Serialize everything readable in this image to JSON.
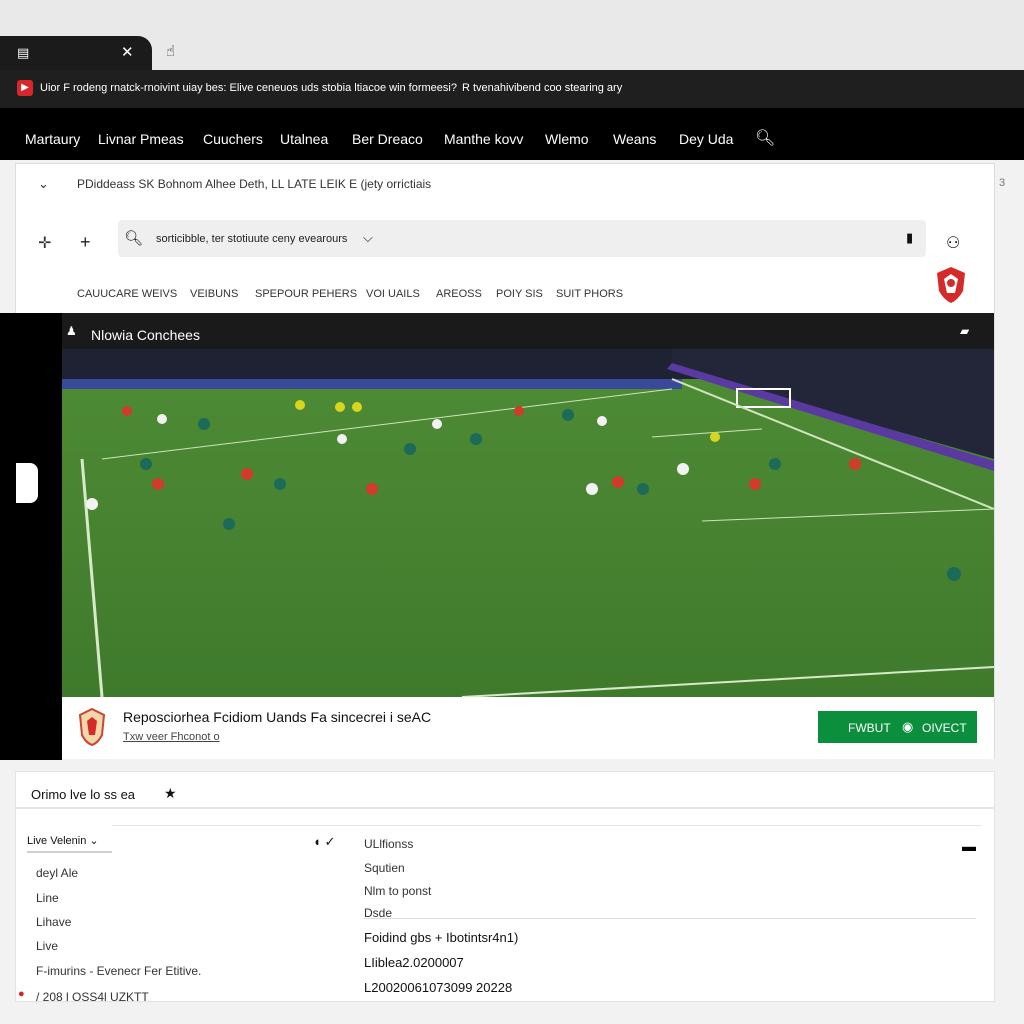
{
  "browser": {
    "tab_close": "✕",
    "new_tab_icon": "☝"
  },
  "alert": {
    "badge": "▶",
    "text_primary": "Uior F rodeng rnatck-rnoivint uiay bes: Elive ceneuos uds stobia ltiacoe win formeesi?",
    "text_secondary": "R  tvenahivibend coo stearing ary"
  },
  "nav": {
    "items": [
      "Martaury",
      "Livnar Pmeas",
      "Cuuchers",
      "Utalnea",
      "Ber Dreaco",
      "Manthe kovv",
      "Wlemo",
      "Weans",
      "Dey Uda"
    ]
  },
  "header": {
    "breadcrumb": "PDiddeass SK Bohnom Alhee Deth, LL LATE LEIK E (jety orrictiais",
    "scroll_indicator": "3",
    "search_text": "sorticibble, ter stotiuute ceny evearours",
    "subnav": [
      "CAUUCARE WEIVS",
      "VEIBUNS",
      "SPEPOUR PEHERS",
      "VOI UAILS",
      "AREOSS",
      "POIY SIS",
      "SUIT PHORS"
    ]
  },
  "video": {
    "title": "Nlowia Conchees",
    "info_title": "Reposciorhea Fcidiom Uands Fa sincecrei i  seAC",
    "info_sub": "Txw veer Fhconot o",
    "btn_left": "FWBUT",
    "btn_right": "OIVECT"
  },
  "section": {
    "title": "Orimo lve lo ss ea",
    "star": "★"
  },
  "bottom": {
    "field_label": "Live Velenin",
    "left_rows": [
      "deyl Ale",
      "Line",
      "Lihave",
      "Live",
      "F-imurins - Evenecr Fer Etitive.",
      "/  208   l OSS4l UZKTT"
    ],
    "right_rows": [
      "ULlfionss",
      "Squtien",
      "Nlm to ponst",
      "Dsde",
      "Foidind gbs + Ibotintsr4n1)",
      "LIiblea2.0200007",
      "L20020061073099 20228"
    ]
  },
  "colors": {
    "accent_green": "#0c8f3c",
    "live_red": "#d9262a",
    "pitch_green": "#4c8a32"
  }
}
